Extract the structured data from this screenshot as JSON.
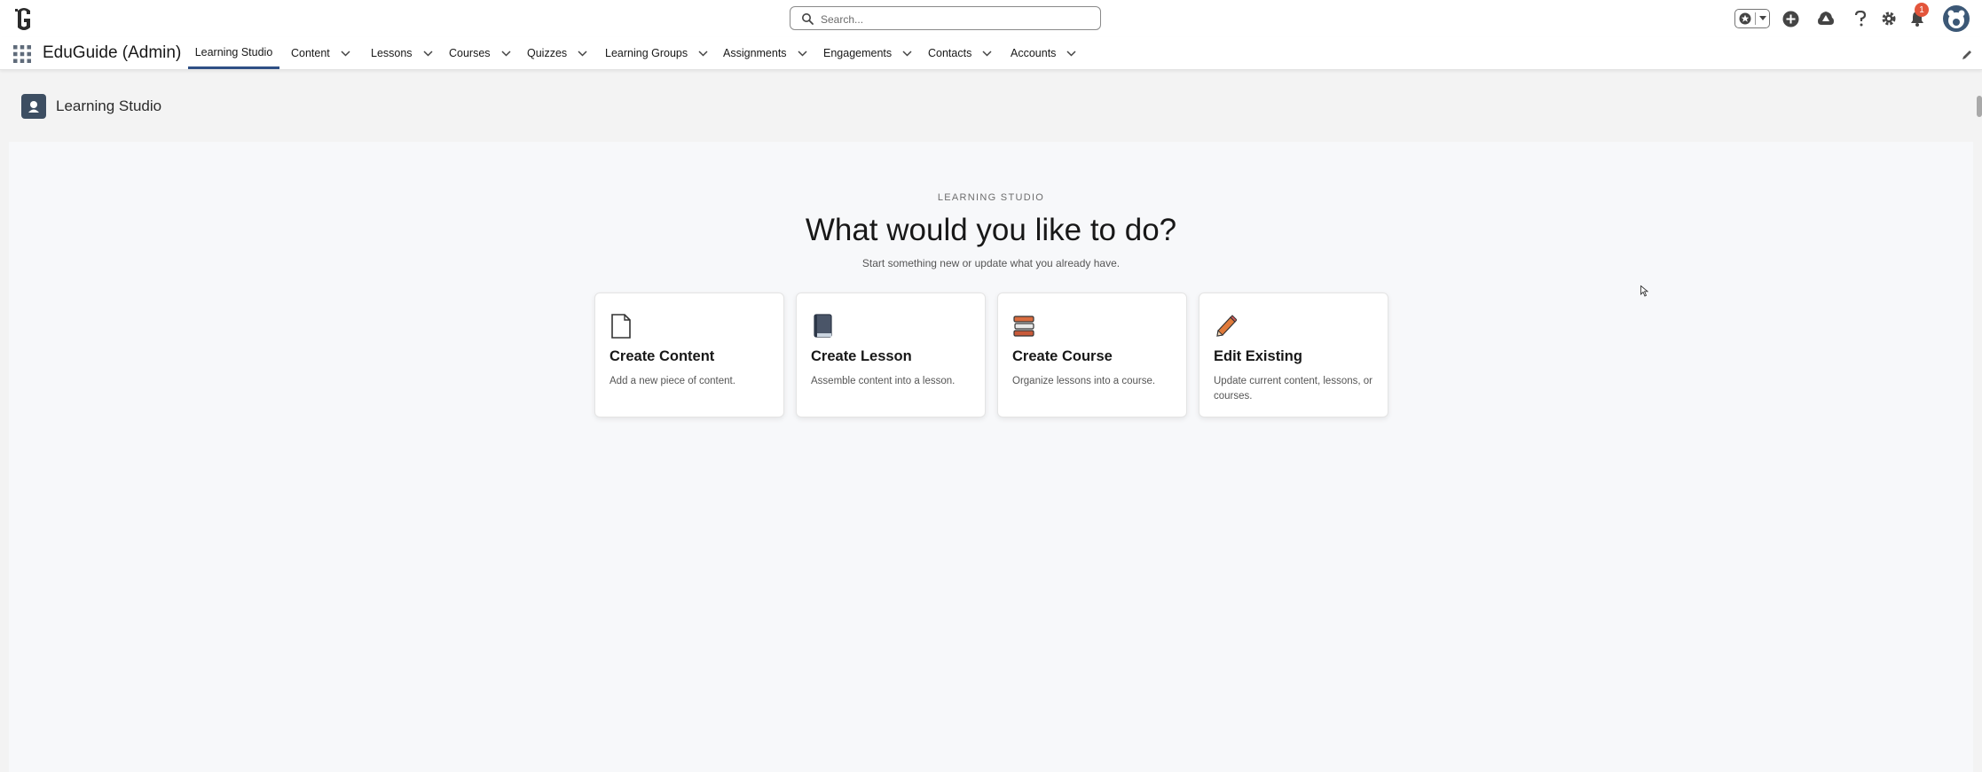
{
  "search": {
    "placeholder": "Search..."
  },
  "notifications": {
    "count": "1"
  },
  "nav": {
    "app_name": "EduGuide (Admin)",
    "tabs": [
      {
        "label": "Learning Studio"
      },
      {
        "label": "Content"
      },
      {
        "label": "Lessons"
      },
      {
        "label": "Courses"
      },
      {
        "label": "Quizzes"
      },
      {
        "label": "Learning Groups"
      },
      {
        "label": "Assignments"
      },
      {
        "label": "Engagements"
      },
      {
        "label": "Contacts"
      },
      {
        "label": "Accounts"
      }
    ]
  },
  "page": {
    "title": "Learning Studio"
  },
  "hero": {
    "eyebrow": "LEARNING STUDIO",
    "headline": "What would you like to do?",
    "subtitle": "Start something new or update what you already have."
  },
  "cards": [
    {
      "title": "Create Content",
      "description": "Add a new piece of content.",
      "icon": "document-icon"
    },
    {
      "title": "Create Lesson",
      "description": "Assemble content into a lesson.",
      "icon": "book-icon"
    },
    {
      "title": "Create Course",
      "description": "Organize lessons into a course.",
      "icon": "books-stack-icon"
    },
    {
      "title": "Edit Existing",
      "description": "Update current content, lessons, or courses.",
      "icon": "pencil-icon"
    }
  ],
  "colors": {
    "accent": "#2e4f85",
    "badge": "#e3553b",
    "header_icon_bg": "#3d4e62"
  }
}
